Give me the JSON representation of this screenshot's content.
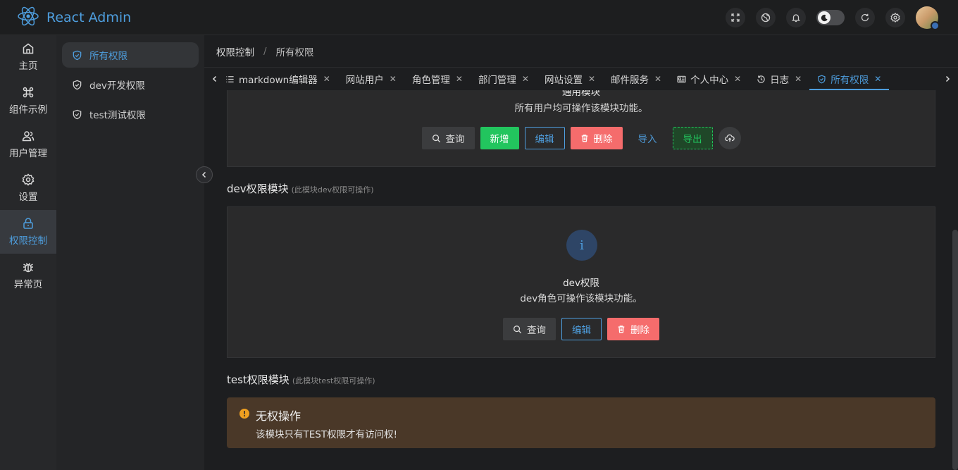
{
  "app": {
    "title": "React Admin"
  },
  "rail": [
    {
      "label": "主页",
      "icon": "home-icon"
    },
    {
      "label": "组件示例",
      "icon": "command-icon"
    },
    {
      "label": "用户管理",
      "icon": "users-icon"
    },
    {
      "label": "设置",
      "icon": "gear-icon"
    },
    {
      "label": "权限控制",
      "icon": "lock-icon",
      "active": true
    },
    {
      "label": "异常页",
      "icon": "bug-icon"
    }
  ],
  "submenu": [
    {
      "label": "所有权限",
      "active": true
    },
    {
      "label": "dev开发权限"
    },
    {
      "label": "test测试权限"
    }
  ],
  "breadcrumb": {
    "parent": "权限控制",
    "sep": "/",
    "current": "所有权限"
  },
  "tabs": [
    {
      "label": "markdown编辑器",
      "icon": "list-icon"
    },
    {
      "label": "网站用户"
    },
    {
      "label": "角色管理"
    },
    {
      "label": "部门管理"
    },
    {
      "label": "网站设置"
    },
    {
      "label": "邮件服务"
    },
    {
      "label": "个人中心",
      "icon": "id-card-icon"
    },
    {
      "label": "日志",
      "icon": "history-icon"
    },
    {
      "label": "所有权限",
      "icon": "shield-icon",
      "active": true
    }
  ],
  "general": {
    "title_partial": "通用模块",
    "desc": "所有用户均可操作该模块功能。",
    "buttons": {
      "query": "查询",
      "add": "新增",
      "edit": "编辑",
      "delete": "删除",
      "import": "导入",
      "export": "导出"
    }
  },
  "dev": {
    "section_title": "dev权限模块",
    "section_hint": "(此模块dev权限可操作)",
    "info_icon": "i",
    "title": "dev权限",
    "desc": "dev角色可操作该模块功能。",
    "buttons": {
      "query": "查询",
      "edit": "编辑",
      "delete": "删除"
    }
  },
  "test": {
    "section_title": "test权限模块",
    "section_hint": "(此模块test权限可操作)",
    "alert_icon": "!",
    "alert_title": "无权操作",
    "alert_desc": "该模块只有TEST权限才有访问权!"
  },
  "colors": {
    "accent": "#4e9ede",
    "success": "#22c55e",
    "danger": "#f56c6c",
    "warning": "#f0a020"
  }
}
